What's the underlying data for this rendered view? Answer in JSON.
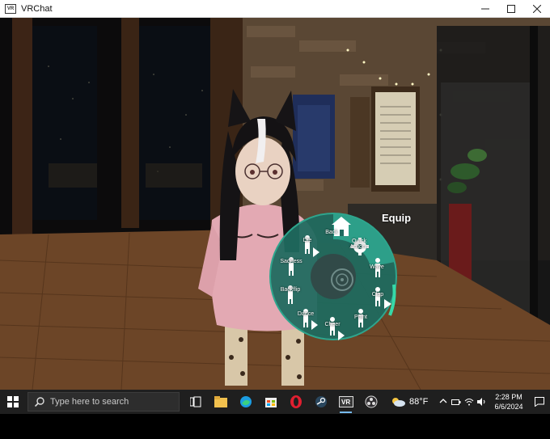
{
  "window": {
    "title": "VRChat",
    "icon_text": "VR",
    "controls": [
      "minimize",
      "maximize",
      "close"
    ]
  },
  "wheel": {
    "equip_label": "Equip",
    "items": [
      {
        "label": "Back",
        "icon": "home-icon"
      },
      {
        "label": "Quick Actions",
        "icon": "gear-icon"
      },
      {
        "label": "Wave",
        "icon": "figure-icon"
      },
      {
        "label": "Clap",
        "icon": "figure-icon"
      },
      {
        "label": "Point",
        "icon": "figure-icon"
      },
      {
        "label": "Cheer",
        "icon": "figure-icon"
      },
      {
        "label": "Dance",
        "icon": "figure-icon"
      },
      {
        "label": "Backflip",
        "icon": "figure-icon"
      },
      {
        "label": "Sadness",
        "icon": "figure-icon"
      },
      {
        "label": "Die",
        "icon": "figure-icon"
      }
    ],
    "accent": "#2fa58e",
    "bg": "#1f6a5f"
  },
  "taskbar": {
    "search_placeholder": "Type here to search",
    "apps": [
      "task-view-icon",
      "file-explorer-icon",
      "edge-icon",
      "store-icon",
      "opera-icon",
      "steam-icon",
      "vrchat-icon",
      "obs-icon"
    ],
    "active_app": "vrchat-icon",
    "weather_temp": "88°F",
    "time": "2:28 PM",
    "date": "6/6/2024"
  },
  "colors": {
    "taskbar": "#1f1f1f",
    "accent": "#76b9ed"
  }
}
